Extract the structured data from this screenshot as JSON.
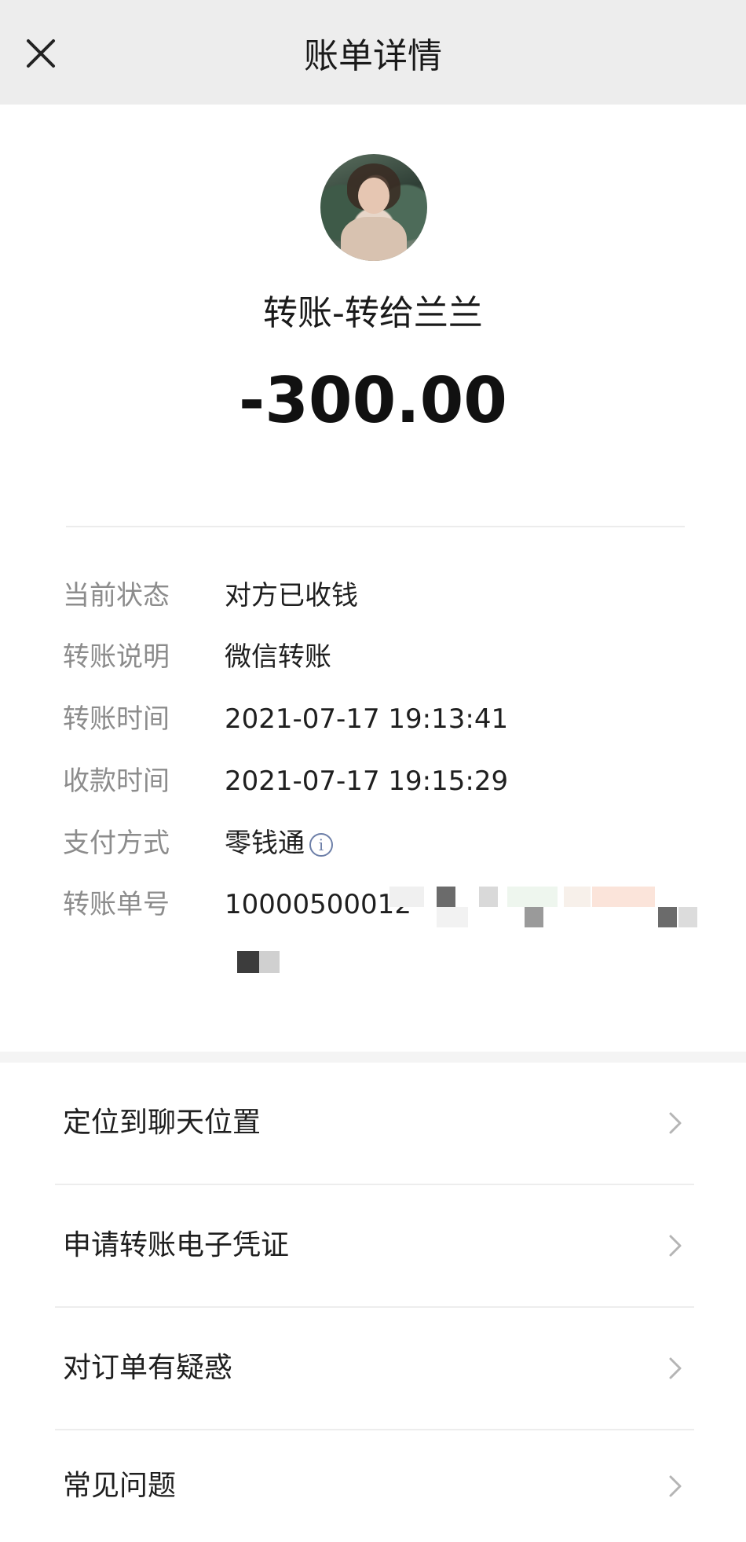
{
  "header": {
    "title": "账单详情",
    "close_icon": "close-icon"
  },
  "summary": {
    "avatar_icon": "avatar",
    "payee": "转账-转给兰兰",
    "amount": "-300.00"
  },
  "details": {
    "rows": [
      {
        "label": "当前状态",
        "value": "对方已收钱"
      },
      {
        "label": "转账说明",
        "value": "微信转账"
      },
      {
        "label": "转账时间",
        "value": "2021-07-17 19:13:41"
      },
      {
        "label": "收款时间",
        "value": "2021-07-17 19:15:29"
      },
      {
        "label": "支付方式",
        "value": "零钱通",
        "icon": "info-icon"
      },
      {
        "label": "转账单号",
        "value": "10000500012"
      }
    ]
  },
  "menu": {
    "items": [
      {
        "label": "定位到聊天位置",
        "icon": "chevron-right-icon"
      },
      {
        "label": "申请转账电子凭证",
        "icon": "chevron-right-icon"
      },
      {
        "label": "对订单有疑惑",
        "icon": "chevron-right-icon"
      },
      {
        "label": "常见问题",
        "icon": "chevron-right-icon"
      }
    ]
  },
  "colors": {
    "topbar_bg": "#ededed",
    "label_gray": "#8c8c8c",
    "info_icon_blue": "#6d7fa8"
  }
}
